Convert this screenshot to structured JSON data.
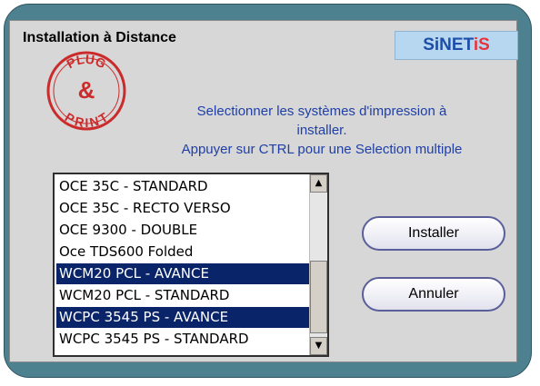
{
  "dialog": {
    "title": "Installation à Distance",
    "brand": {
      "part1": "SiNET",
      "part2": "iS"
    },
    "logo_text": [
      "PLUG",
      "&",
      "PRINT"
    ],
    "message": [
      "Selectionner les systèmes d'impression à",
      "installer.",
      "Appuyer sur CTRL pour une Selection multiple"
    ]
  },
  "printers": {
    "items": [
      {
        "label": "OCE 35C - STANDARD",
        "selected": false
      },
      {
        "label": "OCE 35C - RECTO VERSO",
        "selected": false
      },
      {
        "label": "OCE 9300 - DOUBLE",
        "selected": false
      },
      {
        "label": "Oce TDS600 Folded",
        "selected": false
      },
      {
        "label": "WCM20 PCL - AVANCE",
        "selected": true
      },
      {
        "label": "WCM20 PCL - STANDARD",
        "selected": false
      },
      {
        "label": "WCPC 3545 PS - AVANCE",
        "selected": true
      },
      {
        "label": "WCPC 3545 PS - STANDARD",
        "selected": false
      }
    ],
    "scroll_up": "▲",
    "scroll_down": "▼"
  },
  "buttons": {
    "install": "Installer",
    "cancel": "Annuler"
  },
  "colors": {
    "frame": "#4e8190",
    "panel": "#d7d7d7",
    "selection": "#0a246a",
    "message": "#1f3fa6",
    "logo": "#cc2b2b"
  }
}
